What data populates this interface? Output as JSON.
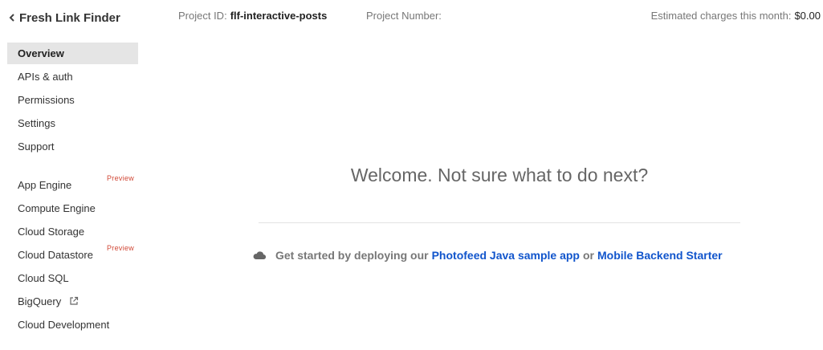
{
  "sidebar": {
    "project_name": "Fresh Link Finder",
    "items": [
      {
        "label": "Overview"
      },
      {
        "label": "APIs & auth"
      },
      {
        "label": "Permissions"
      },
      {
        "label": "Settings"
      },
      {
        "label": "Support"
      },
      {
        "label": "App Engine",
        "badge": "Preview"
      },
      {
        "label": "Compute Engine"
      },
      {
        "label": "Cloud Storage"
      },
      {
        "label": "Cloud Datastore",
        "badge": "Preview"
      },
      {
        "label": "Cloud SQL"
      },
      {
        "label": "BigQuery"
      },
      {
        "label": "Cloud Development"
      }
    ]
  },
  "header": {
    "project_id_label": "Project ID:",
    "project_id_value": "flf-interactive-posts",
    "project_number_label": "Project Number:",
    "charges_label": "Estimated charges this month:",
    "charges_value": "$0.00"
  },
  "main": {
    "welcome": "Welcome. Not sure what to do next?",
    "getting_started": {
      "prefix": "Get started by deploying our",
      "link1": "Photofeed Java sample app",
      "connector": "or",
      "link2": "Mobile Backend Starter"
    }
  },
  "colors": {
    "link": "#1155cc",
    "badge": "#d14836",
    "active_bg": "#e5e5e5"
  },
  "icons": {
    "back": "chevron-left-icon",
    "external": "external-link-icon",
    "cloud": "cloud-icon"
  }
}
